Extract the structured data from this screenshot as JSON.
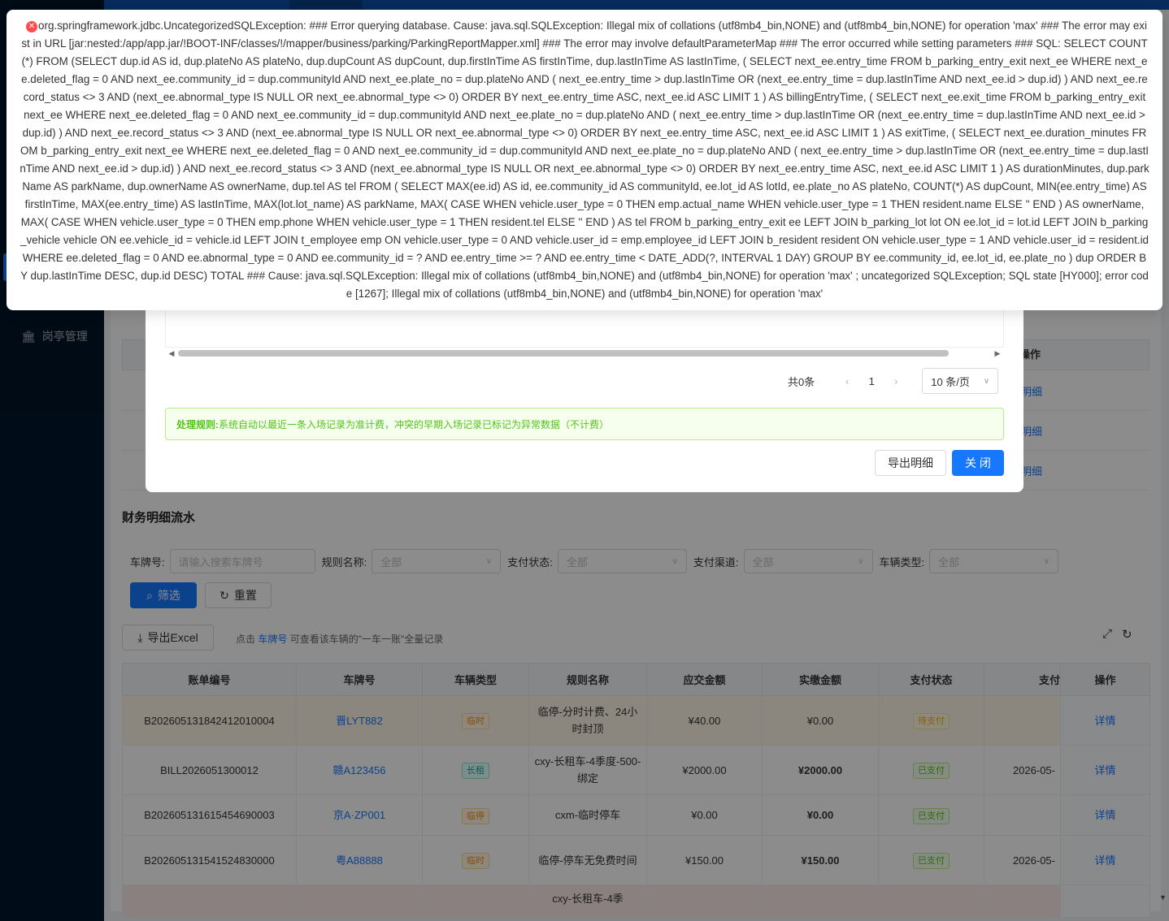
{
  "sidebar": {
    "item": {
      "icon": "building-icon",
      "label": "岗亭管理"
    }
  },
  "background": {
    "op_header": "操作",
    "detail_link": "明细"
  },
  "finance": {
    "section_title": "财务明细流水",
    "filters": {
      "plate_label": "车牌号:",
      "plate_placeholder": "请输入搜索车牌号",
      "rule_label": "规则名称:",
      "rule_value": "全部",
      "pay_status_label": "支付状态:",
      "pay_status_value": "全部",
      "pay_channel_label": "支付渠道:",
      "pay_channel_value": "全部",
      "vehicle_type_label": "车辆类型:",
      "vehicle_type_value": "全部"
    },
    "buttons": {
      "filter": "筛选",
      "reset": "重置",
      "export": "导出Excel"
    },
    "hint": {
      "prefix": "点击",
      "link": "车牌号",
      "suffix": "可查看该车辆的\"一车一账\"全量记录"
    },
    "table": {
      "headers": [
        "账单编号",
        "车牌号",
        "车辆类型",
        "规则名称",
        "应交金额",
        "实缴金额",
        "支付状态",
        "支付",
        "操作"
      ],
      "rows": [
        {
          "bill": "B202605131842412010004",
          "plate": "晋LYT882",
          "type": "临时",
          "rule": "临停-分时计费、24小时封顶",
          "due": "¥40.00",
          "paid": "¥0.00",
          "status": "待支付",
          "pay_time": "",
          "op": "详情"
        },
        {
          "bill": "BILL2026051300012",
          "plate": "赣A123456",
          "type": "长租",
          "rule": "cxy-长租车-4季度-500-绑定",
          "due": "¥2000.00",
          "paid": "¥2000.00",
          "status": "已支付",
          "pay_time": "2026-05-",
          "op": "详情"
        },
        {
          "bill": "B202605131615454690003",
          "plate": "京A·ZP001",
          "type": "临停",
          "rule": "cxm-临时停车",
          "due": "¥0.00",
          "paid": "¥0.00",
          "status": "已支付",
          "pay_time": "",
          "op": "详情"
        },
        {
          "bill": "B202605131541524830000",
          "plate": "粤A88888",
          "type": "临时",
          "rule": "临停-停车无免费时间",
          "due": "¥150.00",
          "paid": "¥150.00",
          "status": "已支付",
          "pay_time": "2026-05-",
          "op": "详情"
        },
        {
          "bill": "",
          "plate": "",
          "type": "",
          "rule": "cxy-长租车-4季",
          "due": "",
          "paid": "",
          "status": "",
          "pay_time": "",
          "op": ""
        }
      ]
    }
  },
  "modal": {
    "pager": {
      "total": "共0条",
      "page": "1",
      "size": "10 条/页"
    },
    "rule": {
      "label": "处理规则:",
      "text": "系统自动以最近一条入场记录为准计费，冲突的早期入场记录已标记为异常数据（不计费）"
    },
    "buttons": {
      "export": "导出明细",
      "close": "关 闭"
    }
  },
  "toast": {
    "type": "error",
    "message": "org.springframework.jdbc.UncategorizedSQLException: ### Error querying database. Cause: java.sql.SQLException: Illegal mix of collations (utf8mb4_bin,NONE) and (utf8mb4_bin,NONE) for operation 'max' ### The error may exist in URL [jar:nested:/app/app.jar/!BOOT-INF/classes/!/mapper/business/parking/ParkingReportMapper.xml] ### The error may involve defaultParameterMap ### The error occurred while setting parameters ### SQL: SELECT COUNT(*) FROM (SELECT dup.id AS id, dup.plateNo AS plateNo, dup.dupCount AS dupCount, dup.firstInTime AS firstInTime, dup.lastInTime AS lastInTime, ( SELECT next_ee.entry_time FROM b_parking_entry_exit next_ee WHERE next_ee.deleted_flag = 0 AND next_ee.community_id = dup.communityId AND next_ee.plate_no = dup.plateNo AND ( next_ee.entry_time > dup.lastInTime OR (next_ee.entry_time = dup.lastInTime AND next_ee.id > dup.id) ) AND next_ee.record_status <> 3 AND (next_ee.abnormal_type IS NULL OR next_ee.abnormal_type <> 0) ORDER BY next_ee.entry_time ASC, next_ee.id ASC LIMIT 1 ) AS billingEntryTime, ( SELECT next_ee.exit_time FROM b_parking_entry_exit next_ee WHERE next_ee.deleted_flag = 0 AND next_ee.community_id = dup.communityId AND next_ee.plate_no = dup.plateNo AND ( next_ee.entry_time > dup.lastInTime OR (next_ee.entry_time = dup.lastInTime AND next_ee.id > dup.id) ) AND next_ee.record_status <> 3 AND (next_ee.abnormal_type IS NULL OR next_ee.abnormal_type <> 0) ORDER BY next_ee.entry_time ASC, next_ee.id ASC LIMIT 1 ) AS exitTime, ( SELECT next_ee.duration_minutes FROM b_parking_entry_exit next_ee WHERE next_ee.deleted_flag = 0 AND next_ee.community_id = dup.communityId AND next_ee.plate_no = dup.plateNo AND ( next_ee.entry_time > dup.lastInTime OR (next_ee.entry_time = dup.lastInTime AND next_ee.id > dup.id) ) AND next_ee.record_status <> 3 AND (next_ee.abnormal_type IS NULL OR next_ee.abnormal_type <> 0) ORDER BY next_ee.entry_time ASC, next_ee.id ASC LIMIT 1 ) AS durationMinutes, dup.parkName AS parkName, dup.ownerName AS ownerName, dup.tel AS tel FROM ( SELECT MAX(ee.id) AS id, ee.community_id AS communityId, ee.lot_id AS lotId, ee.plate_no AS plateNo, COUNT(*) AS dupCount, MIN(ee.entry_time) AS firstInTime, MAX(ee.entry_time) AS lastInTime, MAX(lot.lot_name) AS parkName, MAX( CASE WHEN vehicle.user_type = 0 THEN emp.actual_name WHEN vehicle.user_type = 1 THEN resident.name ELSE '' END ) AS ownerName, MAX( CASE WHEN vehicle.user_type = 0 THEN emp.phone WHEN vehicle.user_type = 1 THEN resident.tel ELSE '' END ) AS tel FROM b_parking_entry_exit ee LEFT JOIN b_parking_lot lot ON ee.lot_id = lot.id LEFT JOIN b_parking_vehicle vehicle ON ee.vehicle_id = vehicle.id LEFT JOIN t_employee emp ON vehicle.user_type = 0 AND vehicle.user_id = emp.employee_id LEFT JOIN b_resident resident ON vehicle.user_type = 1 AND vehicle.user_id = resident.id WHERE ee.deleted_flag = 0 AND ee.abnormal_type = 0 AND ee.community_id = ? AND ee.entry_time >= ? AND ee.entry_time < DATE_ADD(?, INTERVAL 1 DAY) GROUP BY ee.community_id, ee.lot_id, ee.plate_no ) dup ORDER BY dup.lastInTime DESC, dup.id DESC) TOTAL ### Cause: java.sql.SQLException: Illegal mix of collations (utf8mb4_bin,NONE) and (utf8mb4_bin,NONE) for operation 'max' ; uncategorized SQLException; SQL state [HY000]; error code [1267]; Illegal mix of collations (utf8mb4_bin,NONE) and (utf8mb4_bin,NONE) for operation 'max'"
  },
  "colors": {
    "primary": "#1677ff",
    "success": "#52c41a",
    "error": "#ff4d4f",
    "sidebar": "#001529"
  }
}
